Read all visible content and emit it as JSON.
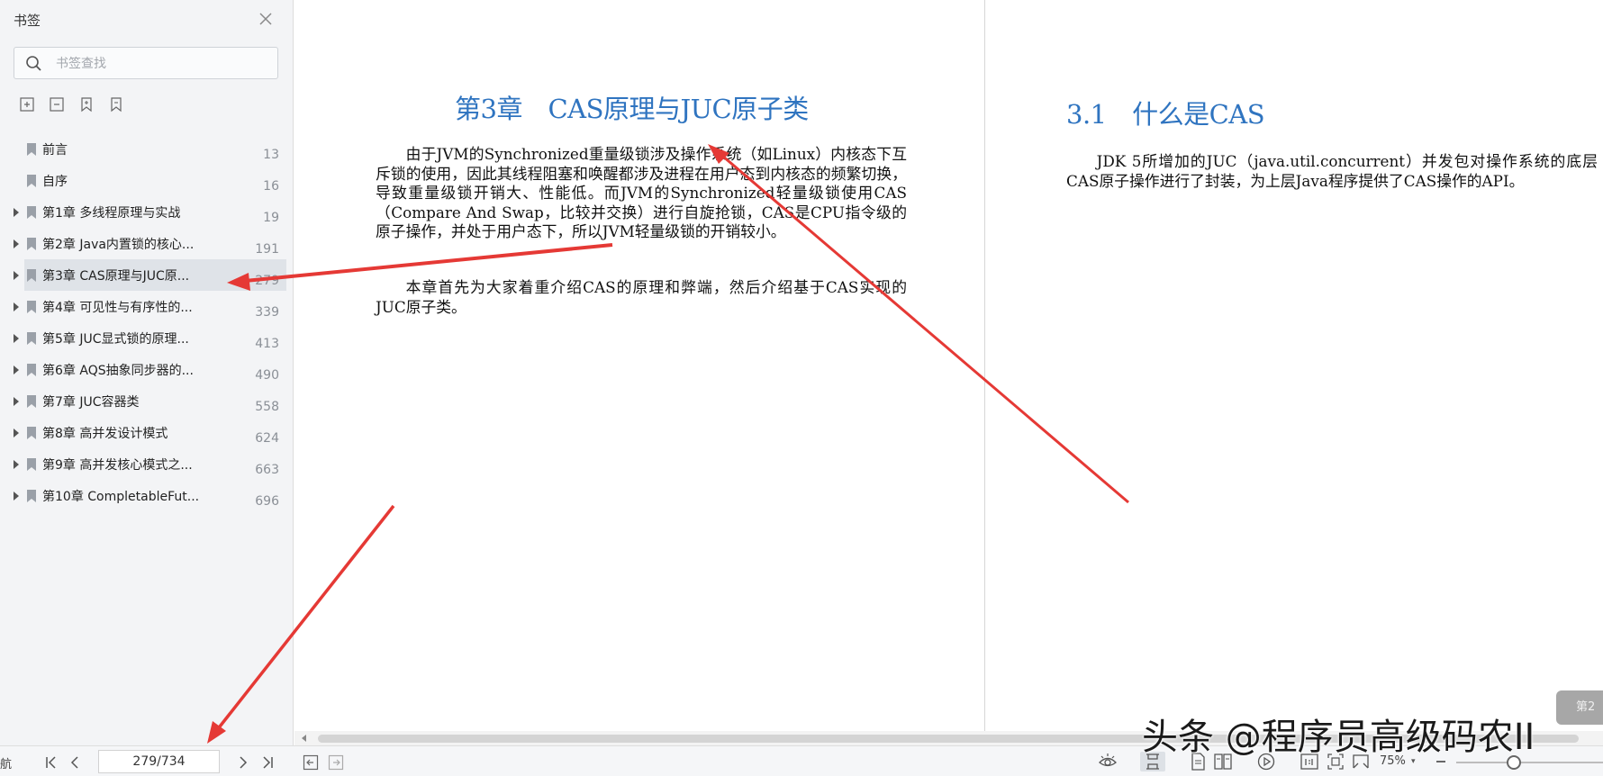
{
  "sidebar": {
    "title": "书签",
    "search_placeholder": "书签查找",
    "items": [
      {
        "label": "前言",
        "page": "13",
        "expandable": false
      },
      {
        "label": "自序",
        "page": "16",
        "expandable": false
      },
      {
        "label": "第1章 多线程原理与实战",
        "page": "19",
        "expandable": true
      },
      {
        "label": "第2章 Java内置锁的核心...",
        "page": "191",
        "expandable": true
      },
      {
        "label": "第3章 CAS原理与JUC原...",
        "page": "279",
        "expandable": true,
        "selected": true
      },
      {
        "label": "第4章 可见性与有序性的...",
        "page": "339",
        "expandable": true
      },
      {
        "label": "第5章 JUC显式锁的原理...",
        "page": "413",
        "expandable": true
      },
      {
        "label": "第6章 AQS抽象同步器的...",
        "page": "490",
        "expandable": true
      },
      {
        "label": "第7章 JUC容器类",
        "page": "558",
        "expandable": true
      },
      {
        "label": "第8章 高并发设计模式",
        "page": "624",
        "expandable": true
      },
      {
        "label": "第9章 高并发核心模式之...",
        "page": "663",
        "expandable": true
      },
      {
        "label": "第10章 CompletableFut...",
        "page": "696",
        "expandable": true
      }
    ]
  },
  "document": {
    "left_page": {
      "chapter_title": "第3章　CAS原理与JUC原子类",
      "paragraphs": [
        "由于JVM的Synchronized重量级锁涉及操作系统（如Linux）内核态下互斥锁的使用，因此其线程阻塞和唤醒都涉及进程在用户态到内核态的频繁切换，导致重量级锁开销大、性能低。而JVM的Synchronized轻量级锁使用CAS（Compare And Swap，比较并交换）进行自旋抢锁，CAS是CPU指令级的原子操作，并处于用户态下，所以JVM轻量级锁的开销较小。",
        "本章首先为大家着重介绍CAS的原理和弊端，然后介绍基于CAS实现的JUC原子类。"
      ]
    },
    "right_page": {
      "section_title": "3.1　什么是CAS",
      "paragraphs": [
        "JDK 5所增加的JUC（java.util.concurrent）并发包对操作系统的底层CAS原子操作进行了封装，为上层Java程序提供了CAS操作的API。"
      ]
    },
    "page_badge": "第2"
  },
  "statusbar": {
    "nav_label": "航",
    "page_value": "279/734",
    "zoom": "75%"
  },
  "watermark": "头条 @程序员高级码农II",
  "colors": {
    "heading": "#2f74c0",
    "annotation_arrow": "#e53935",
    "sidebar_bg": "#f3f4f6",
    "selected_bg": "#dfe3e8"
  }
}
